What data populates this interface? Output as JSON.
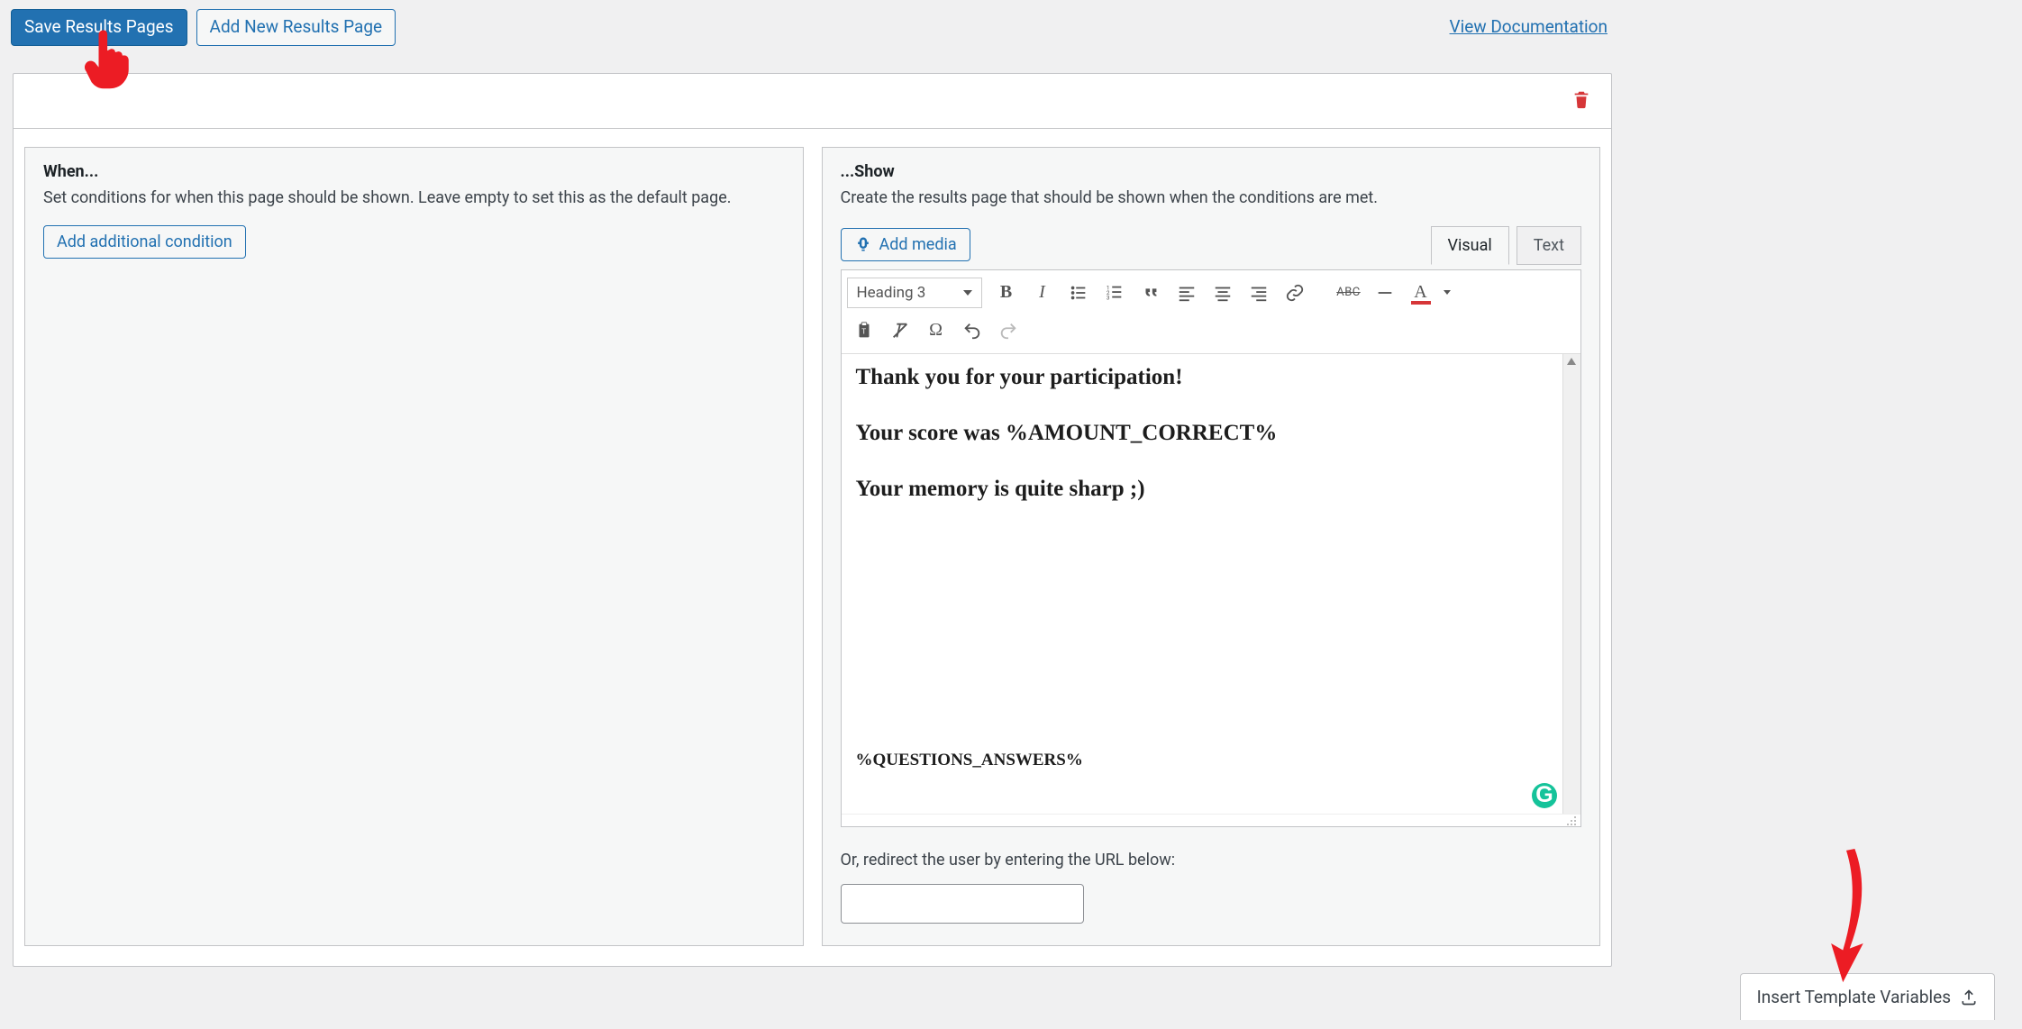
{
  "topbar": {
    "save_label": "Save Results Pages",
    "add_label": "Add New Results Page",
    "doc_link": "View Documentation"
  },
  "when_pane": {
    "title": "When...",
    "description": "Set conditions for when this page should be shown. Leave empty to set this as the default page.",
    "add_condition_label": "Add additional condition"
  },
  "show_pane": {
    "title": "...Show",
    "description": "Create the results page that should be shown when the conditions are met.",
    "add_media_label": "Add media",
    "tabs": {
      "visual": "Visual",
      "text": "Text"
    },
    "heading_select": "Heading 3",
    "toolbar": {
      "abc": "ABC"
    },
    "content": {
      "line1": "Thank you for your participation!",
      "line2": "Your score was %AMOUNT_CORRECT%",
      "line3": "Your memory is quite sharp ;)",
      "bottom": "%QUESTIONS_ANSWERS%"
    },
    "redirect_label": "Or, redirect the user by entering the URL below:",
    "redirect_value": ""
  },
  "icons": {
    "trash": "trash-icon",
    "media": "media-icon",
    "hand": "hand-pointer-icon",
    "arrow": "down-arrow-icon",
    "upload": "upload-icon"
  },
  "footer": {
    "insert_vars_label": "Insert Template Variables"
  }
}
